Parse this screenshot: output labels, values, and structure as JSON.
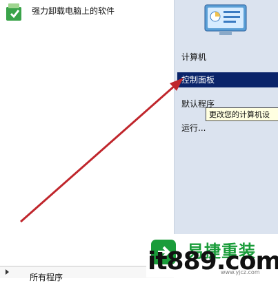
{
  "start_menu": {
    "pinned_program": "强力卸载电脑上的软件",
    "all_programs": "所有程序",
    "right_items": [
      {
        "label": "计算机"
      },
      {
        "label": "控制面板"
      },
      {
        "label": "默认程序"
      },
      {
        "label": "运行..."
      }
    ],
    "tooltip": "更改您的计算机设"
  },
  "watermark": {
    "brand_cn": "易捷重装",
    "domain": "it889.com",
    "sub": "www.yjcz.com"
  }
}
